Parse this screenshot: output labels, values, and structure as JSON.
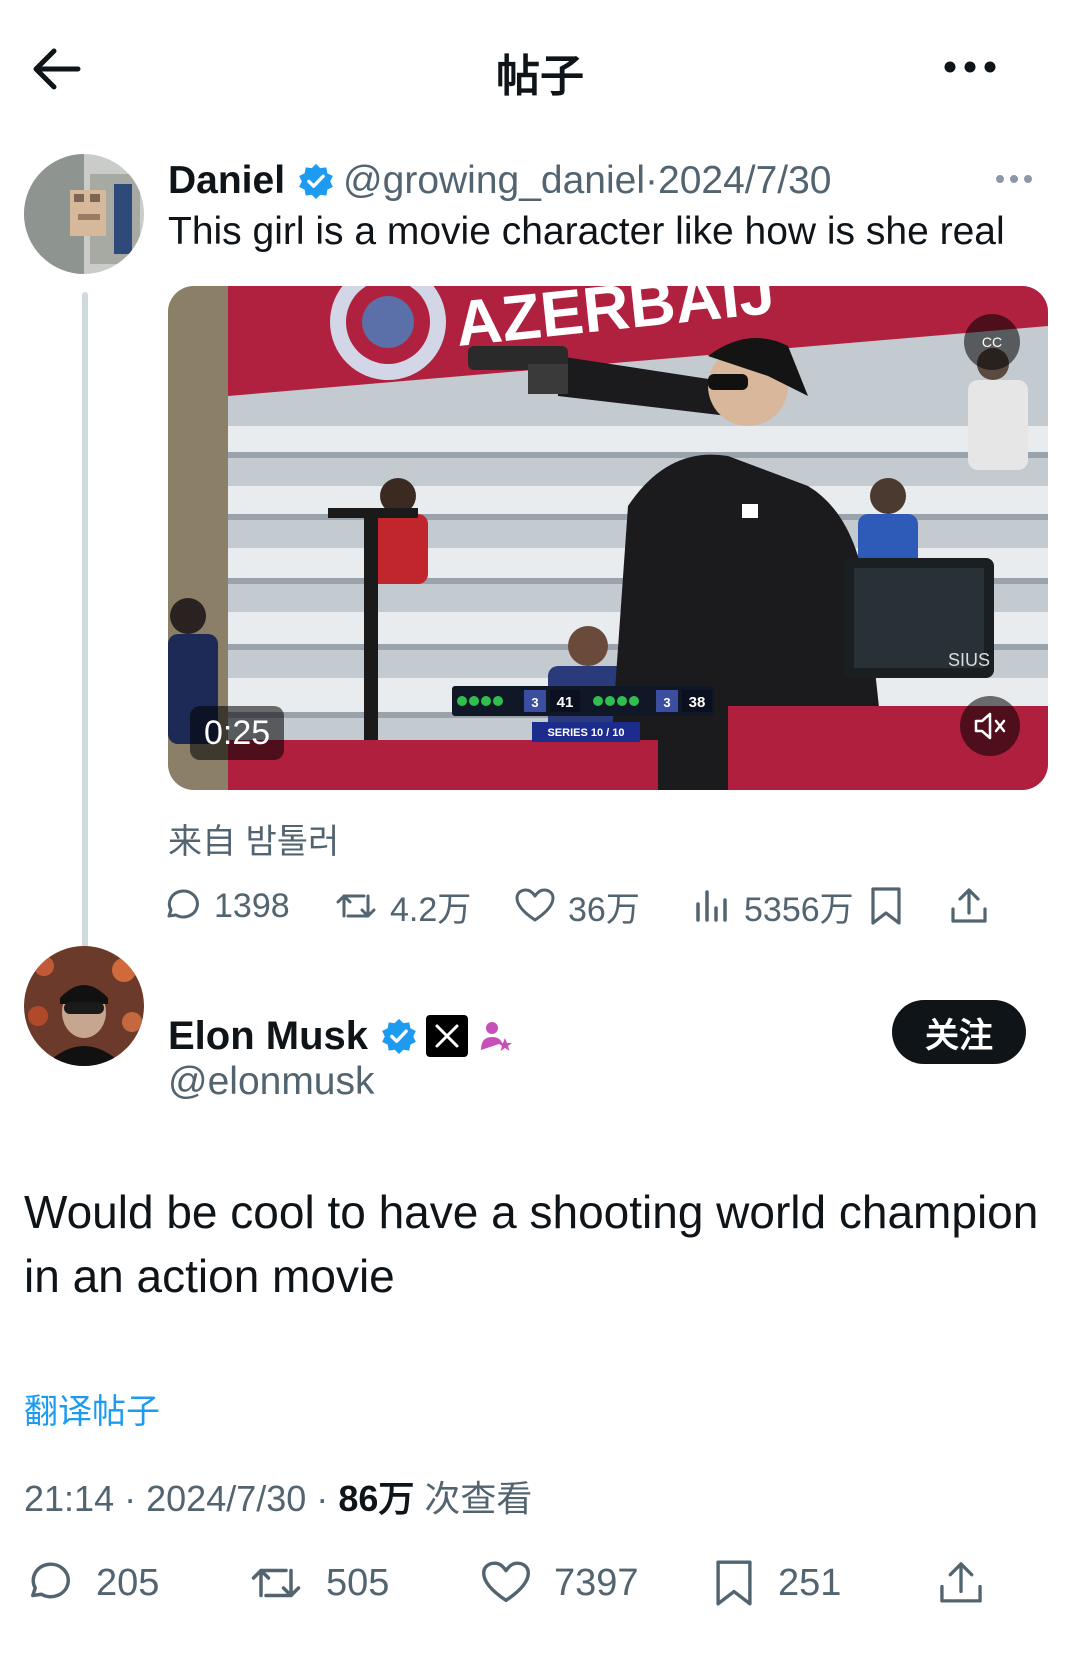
{
  "header": {
    "title": "帖子"
  },
  "quoted_post": {
    "display_name": "Daniel",
    "handle": "@growing_daniel",
    "separator": "·",
    "date": "2024/7/30",
    "text": "This girl is a movie character like how is she real",
    "video": {
      "banner_text": "AZERBAIJ",
      "duration": "0:25",
      "cc_label": "CC",
      "scoreboard": {
        "left_score": "41",
        "left_sets": "3",
        "right_score": "38",
        "right_sets": "3",
        "series": "SERIES 10 / 10"
      },
      "monitor_label": "SIUS"
    },
    "source": "来自 밤톨러",
    "stats": {
      "replies": "1398",
      "reposts": "4.2万",
      "likes": "36万",
      "views": "5356万"
    }
  },
  "main_post": {
    "display_name": "Elon Musk",
    "handle": "@elonmusk",
    "follow_label": "关注",
    "text": "Would be cool to have a shooting world champion in an action movie",
    "translate_label": "翻译帖子",
    "time": "21:14",
    "separator": "·",
    "date": "2024/7/30",
    "views_count": "86万",
    "views_suffix": "次查看",
    "stats": {
      "replies": "205",
      "reposts": "505",
      "likes": "7397",
      "bookmarks": "251"
    }
  },
  "colors": {
    "text_primary": "#0f1419",
    "text_secondary": "#536471",
    "verified_blue": "#1d9bf0",
    "link_blue": "#1d9bf0",
    "thread_line": "#cfd9de"
  },
  "icons": {
    "back": "arrow-left-icon",
    "more": "more-horizontal-icon",
    "verified": "verified-badge-icon",
    "reply": "reply-icon",
    "repost": "repost-icon",
    "like": "heart-icon",
    "views": "views-chart-icon",
    "bookmark": "bookmark-icon",
    "share": "share-icon",
    "affiliate": "affiliate-badge-icon",
    "x_logo": "x-logo-icon",
    "mute": "mute-icon"
  }
}
